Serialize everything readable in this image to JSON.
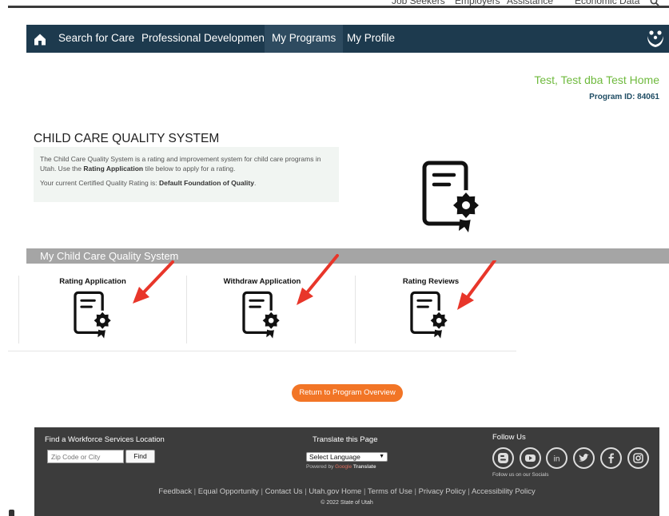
{
  "utility_nav": {
    "items": [
      "Job Seekers",
      "Employers",
      "Assistance",
      "Economic Data"
    ],
    "search_icon": "search-icon"
  },
  "main_nav": {
    "home_icon": "home-icon",
    "items": [
      "Search for Care",
      "Professional Development",
      "My Programs",
      "My Profile"
    ],
    "active": "My Programs",
    "logo_icon": "family-logo-icon"
  },
  "account": {
    "name": "Test, Test dba Test Home",
    "program_id": "Program ID: 84061"
  },
  "ccqs": {
    "title": "CHILD CARE QUALITY SYSTEM",
    "desc_before": "The Child Care Quality System is a rating and improvement system for child care programs in Utah. Use the ",
    "desc_bold": "Rating Application",
    "desc_after": " tile below to apply for a rating.",
    "rating_before": "Your current Certified Quality Rating is: ",
    "rating_bold": "Default Foundation of Quality",
    "rating_after": "."
  },
  "tiles_section": {
    "heading": "My Child Care Quality System",
    "tiles": [
      {
        "label": "Rating Application",
        "icon": "certificate-icon"
      },
      {
        "label": "Withdraw Application",
        "icon": "certificate-icon"
      },
      {
        "label": "Rating Reviews",
        "icon": "certificate-icon"
      }
    ]
  },
  "return_button": "Return to Program Overview",
  "footer": {
    "location_title": "Find a Workforce Services Location",
    "zip_placeholder": "Zip Code or City",
    "find_label": "Find",
    "translate_title": "Translate this Page",
    "select_language": "Select Language",
    "powered_by": "Powered by",
    "google": "Google",
    "translate": "Translate",
    "follow_title": "Follow Us",
    "follow_note": "Follow us on our Socials",
    "socials": [
      "blogger-icon",
      "youtube-icon",
      "linkedin-icon",
      "twitter-icon",
      "facebook-icon",
      "instagram-icon"
    ],
    "links": [
      "Feedback",
      "Equal Opportunity",
      "Contact Us",
      "Utah.gov Home",
      "Terms of Use",
      "Privacy Policy",
      "Accessibility Policy"
    ],
    "copyright": "© 2022 State of Utah"
  },
  "colors": {
    "nav_bg": "#1d3a4e",
    "user_green": "#6fba3e",
    "program_blue": "#1f4d64",
    "band_gray": "#a5a5a5",
    "button_orange": "#f27526",
    "footer_bg": "#3c3c3c",
    "arrow_red": "#e8362a"
  }
}
